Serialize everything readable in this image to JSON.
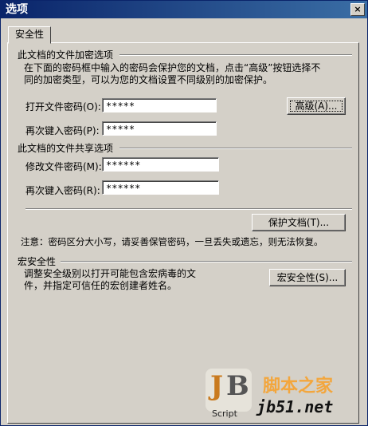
{
  "window": {
    "title": "选项",
    "close_glyph": "×"
  },
  "tab": {
    "label": "安全性"
  },
  "encryption": {
    "section_title": "此文档的文件加密选项",
    "description_line1": "在下面的密码框中输入的密码会保护您的文档，点击“高级”按钮选择不",
    "description_line2": "同的加密类型，可以为您的文档设置不同级别的加密保护。",
    "open_password_label": "打开文件密码(O):",
    "open_password_value": "*****",
    "reenter_label": "再次键入密码(P):",
    "reenter_value": "*****",
    "advanced_button": "高级(A)..."
  },
  "sharing": {
    "section_title": "此文档的文件共享选项",
    "modify_password_label": "修改文件密码(M):",
    "modify_password_value": "******",
    "reenter_label": "再次键入密码(R):",
    "reenter_value": "******",
    "protect_button": "保护文档(T)...",
    "notice": "注意：密码区分大小写，请妥善保管密码，一旦丢失或遗忘，则无法恢复。"
  },
  "macro": {
    "section_title": "宏安全性",
    "description_line1": "调整安全级别以打开可能包含宏病毒的文",
    "description_line2": "件，并指定可信任的宏创建者姓名。",
    "button": "宏安全性(S)..."
  },
  "watermark": {
    "site_name": "脚本之家",
    "url": "jb51.net",
    "logo_tag": "Script"
  }
}
